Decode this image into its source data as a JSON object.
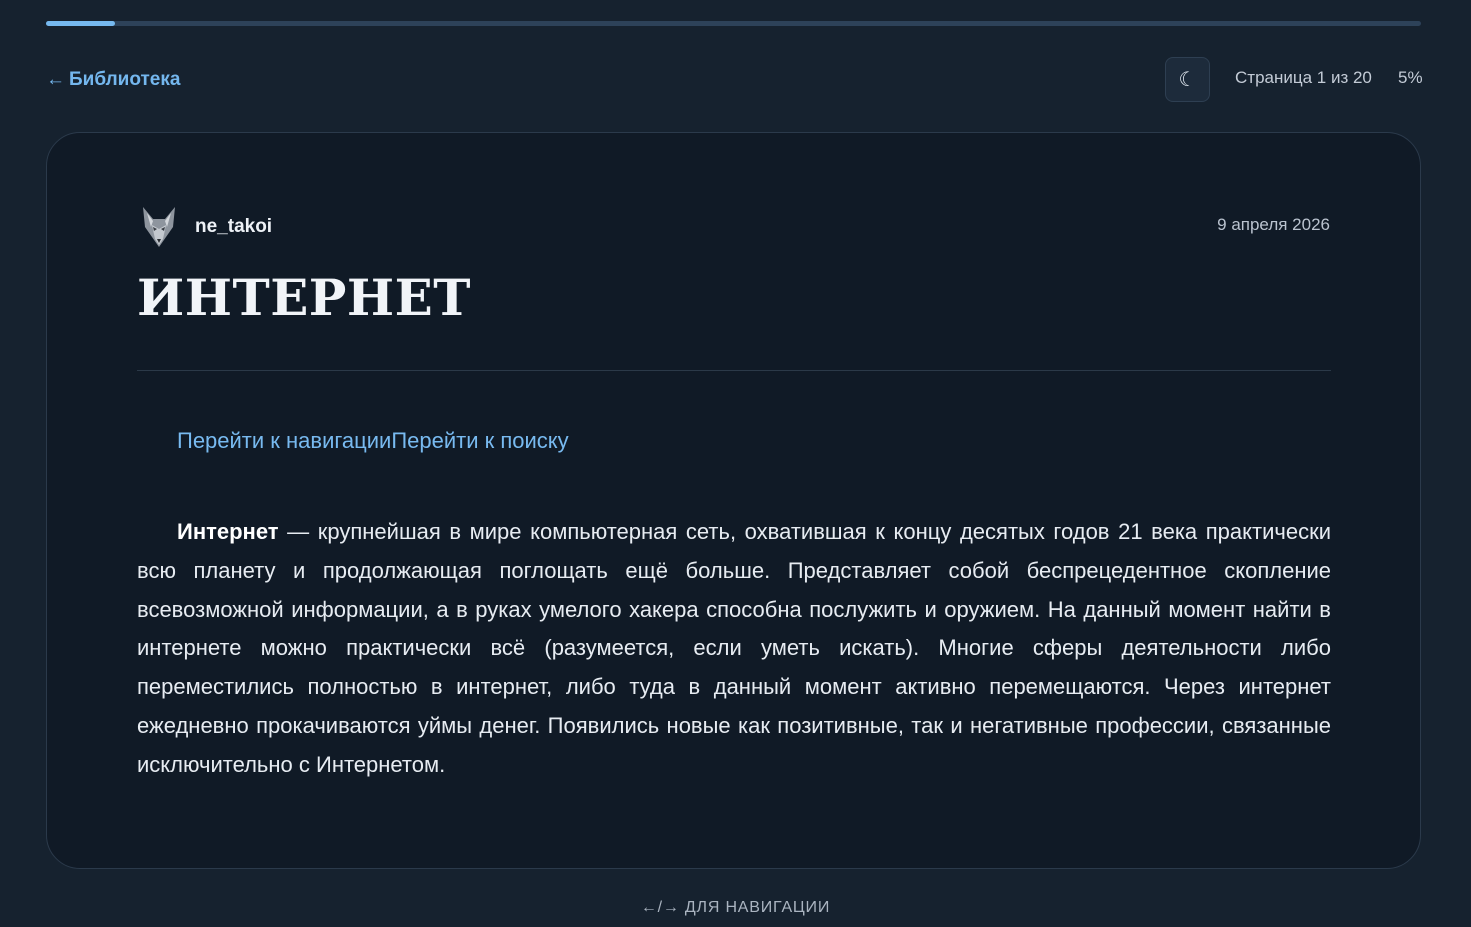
{
  "progress": {
    "percent": 5
  },
  "header": {
    "back_arrow": "←",
    "back_label": "Библиотека",
    "theme_icon": "☾",
    "page_indicator": "Страница 1 из 20",
    "page_percent": "5%"
  },
  "article": {
    "author": "ne_takoi",
    "date": "9 апреля 2026",
    "title": "ИНТЕРНЕТ",
    "skip_nav": "Перейти к навигации",
    "skip_search": "Перейти к поиску",
    "lead_term": "Интернет",
    "body": " — крупнейшая в мире компьютерная сеть, охватившая к концу десятых годов 21 века практически всю планету и продолжающая поглощать ещё больше. Представляет собой беспрецедентное скопление всевозможной информации, а в руках умелого хакера способна послужить и оружием. На данный момент найти в интернете можно практически всё (разумеется, если уметь искать). Многие сферы деятельности либо переместились полностью в интернет, либо туда в данный момент активно перемещаются. Через интернет ежедневно прокачиваются уймы денег. Появились новые как позитивные, так и негативные профессии, связанные исключительно с Интернетом."
  },
  "footer": {
    "nav_hint": "←/→ ДЛЯ НАВИГАЦИИ"
  },
  "colors": {
    "background": "#16222f",
    "card": "#101a26",
    "accent": "#76b9ef",
    "text": "#e7ecf2"
  },
  "icons": {
    "avatar": "fox-avatar-icon",
    "theme": "moon-icon",
    "back": "arrow-left-icon"
  }
}
